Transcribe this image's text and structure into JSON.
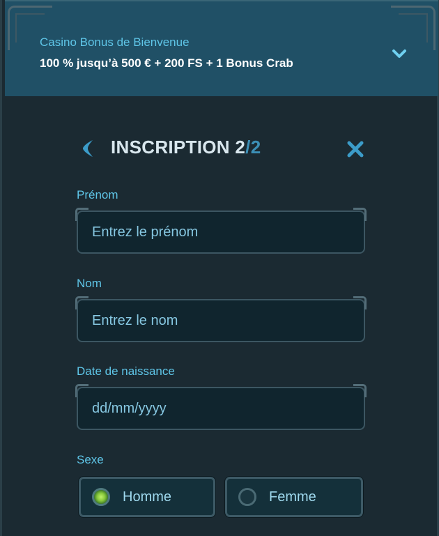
{
  "bonus": {
    "title": "Casino Bonus de Bienvenue",
    "description": "100 % jusqu’à 500 € + 200 FS + 1 Bonus Crab"
  },
  "form": {
    "title": "INSCRIPTION 2",
    "slash": "/",
    "total": "2",
    "fields": {
      "first_name": {
        "label": "Prénom",
        "placeholder": "Entrez le prénom"
      },
      "last_name": {
        "label": "Nom",
        "placeholder": "Entrez le nom"
      },
      "birth_date": {
        "label": "Date de naissance",
        "placeholder": "dd/mm/yyyy"
      }
    },
    "gender": {
      "label": "Sexe",
      "options": [
        "Homme",
        "Femme"
      ],
      "selected": "Homme"
    }
  },
  "colors": {
    "accent": "#5fc6e8",
    "header_bg": "#205066",
    "panel_bg": "#1b2a32",
    "radio_selected": "#86c83a"
  },
  "icons": {
    "expand": "chevron-down-icon",
    "back": "chevron-left-icon",
    "close": "close-icon"
  }
}
